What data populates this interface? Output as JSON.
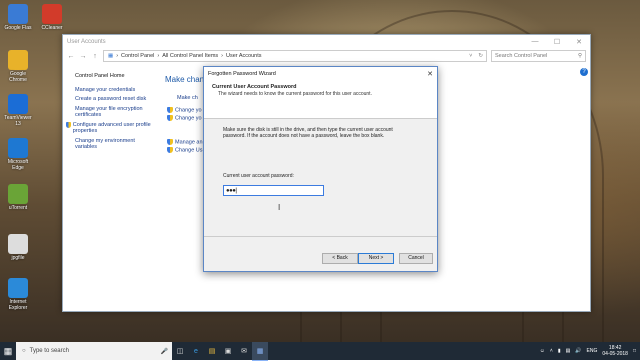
{
  "desktop": {
    "icons": [
      {
        "label": "Google Flas",
        "icon": "app-icon",
        "color": "#3a7bd5"
      },
      {
        "label": "CCleaner",
        "icon": "ccleaner-icon",
        "color": "#d23b2a"
      },
      {
        "label": "Google Chrome",
        "icon": "chrome-icon",
        "color": "#e8b22a"
      },
      {
        "label": "TeamViewer 13",
        "icon": "teamviewer-icon",
        "color": "#1b6dd6"
      },
      {
        "label": "Microsoft Edge",
        "icon": "edge-icon",
        "color": "#1e78d2"
      },
      {
        "label": "uTorrent",
        "icon": "utorrent-icon",
        "color": "#6aa437"
      },
      {
        "label": "jpgfile",
        "icon": "image-file-icon",
        "color": "#dddddd"
      },
      {
        "label": "Internet Explorer",
        "icon": "ie-icon",
        "color": "#2b8ad9"
      }
    ]
  },
  "control_panel": {
    "title": "User Accounts",
    "breadcrumb": [
      "Control Panel",
      "All Control Panel Items",
      "User Accounts"
    ],
    "search_placeholder": "Search Control Panel",
    "left_nav": {
      "home": "Control Panel Home",
      "items": [
        "Manage your credentials",
        "Create a password reset disk",
        "Manage your file encryption certificates",
        "Configure advanced user profile properties",
        "Change my environment variables"
      ]
    },
    "main_heading": "Make chan",
    "links": [
      "Make ch",
      "Change yo",
      "Change yo",
      "Manage an",
      "Change Us"
    ]
  },
  "wizard": {
    "title": "Forgotten Password Wizard",
    "heading": "Current User Account Password",
    "subheading": "The wizard needs to know the current password for this user account.",
    "description": "Make sure the disk is still in the drive, and then type the current user account password. If the account does not have a password, leave the box blank.",
    "field_label": "Current user account password:",
    "password_value": "●●●",
    "back_label": "< Back",
    "next_label": "Next >",
    "cancel_label": "Cancel"
  },
  "taskbar": {
    "search_placeholder": "Type to search",
    "language": "ENG",
    "time": "18:42",
    "date": "04-05-2018"
  }
}
